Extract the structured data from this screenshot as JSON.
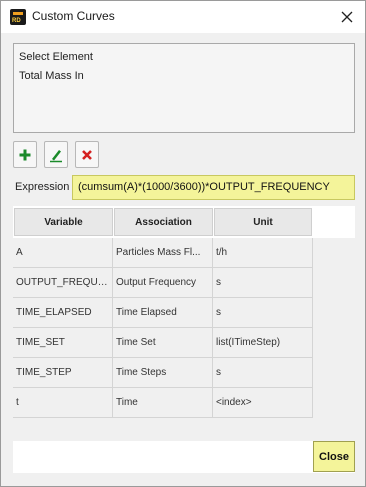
{
  "window": {
    "title": "Custom Curves",
    "icon": "app-logo-icon",
    "close_icon": "close-icon"
  },
  "element_list": {
    "items": [
      "Select Element",
      "Total Mass In"
    ]
  },
  "toolbar": {
    "add_icon": "plus-icon",
    "edit_icon": "pencil-icon",
    "delete_icon": "delete-x-icon",
    "add_color": "#1a8a2a",
    "edit_color": "#1a8a2a",
    "delete_color": "#d42020"
  },
  "expression": {
    "label": "Expression",
    "value": "(cumsum(A)*(1000/3600))*OUTPUT_FREQUENCY",
    "field_color": "#f4f49a"
  },
  "table": {
    "columns": [
      "Variable",
      "Association",
      "Unit"
    ],
    "rows": [
      {
        "variable": "A",
        "association": "Particles Mass Fl...",
        "unit": "t/h"
      },
      {
        "variable": "OUTPUT_FREQUE...",
        "association": "Output Frequency",
        "unit": "s"
      },
      {
        "variable": "TIME_ELAPSED",
        "association": "Time Elapsed",
        "unit": "s"
      },
      {
        "variable": "TIME_SET",
        "association": "Time Set",
        "unit": "list(ITimeStep)"
      },
      {
        "variable": "TIME_STEP",
        "association": "Time Steps",
        "unit": "s"
      },
      {
        "variable": "t",
        "association": "Time",
        "unit": "<index>"
      }
    ]
  },
  "footer": {
    "close_label": "Close"
  }
}
